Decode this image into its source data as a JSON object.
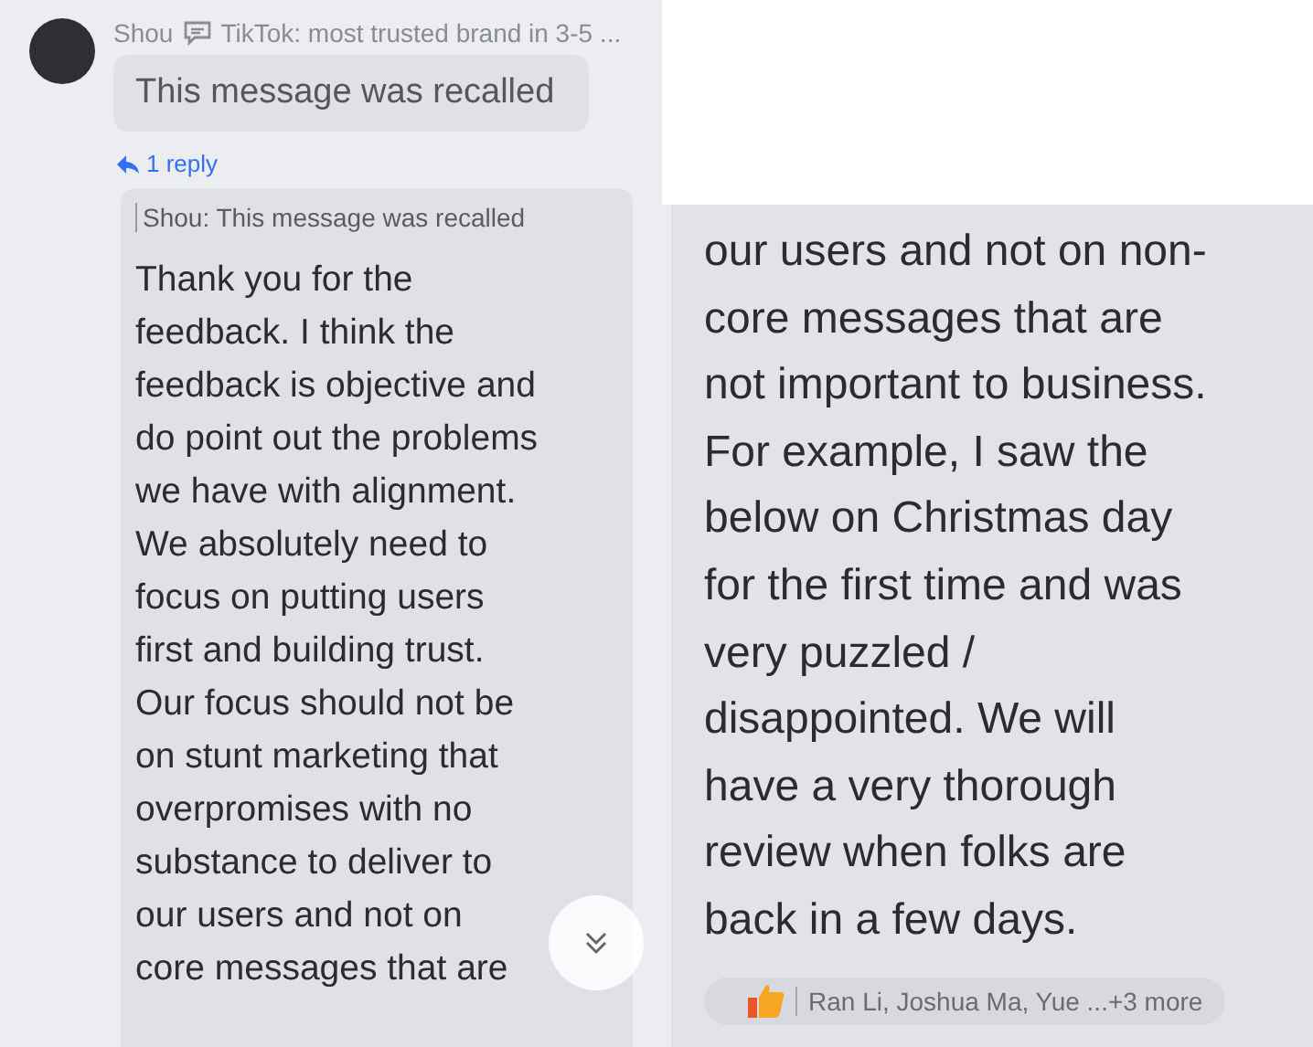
{
  "left_screen": {
    "sender": "Shou",
    "topic": "TikTok: most trusted brand in 3-5 ...",
    "recalled_message": "This message was recalled",
    "reply_count": "1 reply",
    "quote": "Shou: This message was recalled",
    "lines": [
      "Thank you for the",
      "feedback. I think the",
      "feedback is objective and",
      "do point out the problems",
      "we have with alignment.",
      "We absolutely need to",
      "focus on putting users",
      "first and building trust.",
      "Our focus should not be",
      "on stunt marketing that",
      "overpromises with no",
      "substance to deliver to",
      "our users and not on",
      "core messages that are"
    ]
  },
  "right_screen": {
    "lines": [
      "our users and not on non-",
      "core messages that are",
      "not important to business.",
      "For example, I saw the",
      "below on Christmas day",
      "for the first time and was",
      "very puzzled /",
      "disappointed. We will",
      "have a very thorough",
      "review when folks are",
      "back in a few days."
    ],
    "reactions": "Ran Li, Joshua Ma, Yue ...+3 more"
  }
}
